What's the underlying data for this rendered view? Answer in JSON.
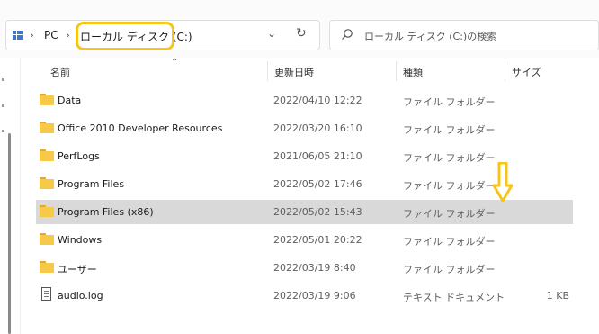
{
  "breadcrumb": {
    "pc": "PC",
    "drive": "ローカル ディスク (C:)"
  },
  "icons": {
    "chevron": "›",
    "dropdown": "⌄",
    "refresh": "↻"
  },
  "search": {
    "placeholder": "ローカル ディスク (C:)の検索"
  },
  "columns": {
    "name": "名前",
    "date": "更新日時",
    "type": "種類",
    "size": "サイズ"
  },
  "files": [
    {
      "name": "Data",
      "date": "2022/04/10 12:22",
      "type": "ファイル フォルダー",
      "size": "",
      "kind": "folder"
    },
    {
      "name": "Office 2010 Developer Resources",
      "date": "2022/03/20 16:10",
      "type": "ファイル フォルダー",
      "size": "",
      "kind": "folder"
    },
    {
      "name": "PerfLogs",
      "date": "2021/06/05 21:10",
      "type": "ファイル フォルダー",
      "size": "",
      "kind": "folder"
    },
    {
      "name": "Program Files",
      "date": "2022/05/02 17:46",
      "type": "ファイル フォルダー",
      "size": "",
      "kind": "folder"
    },
    {
      "name": "Program Files (x86)",
      "date": "2022/05/02 15:43",
      "type": "ファイル フォルダー",
      "size": "",
      "kind": "folder",
      "selected": true
    },
    {
      "name": "Windows",
      "date": "2022/05/01 20:22",
      "type": "ファイル フォルダー",
      "size": "",
      "kind": "folder"
    },
    {
      "name": "ユーザー",
      "date": "2022/03/19 8:40",
      "type": "ファイル フォルダー",
      "size": "",
      "kind": "folder"
    },
    {
      "name": "audio.log",
      "date": "2022/03/19 9:06",
      "type": "テキスト ドキュメント",
      "size": "1 KB",
      "kind": "file"
    }
  ],
  "colors": {
    "highlight": "#f5c518",
    "selected_row": "#d9d9d9",
    "folder": "#f7c948",
    "accent": "#3b78d6"
  }
}
